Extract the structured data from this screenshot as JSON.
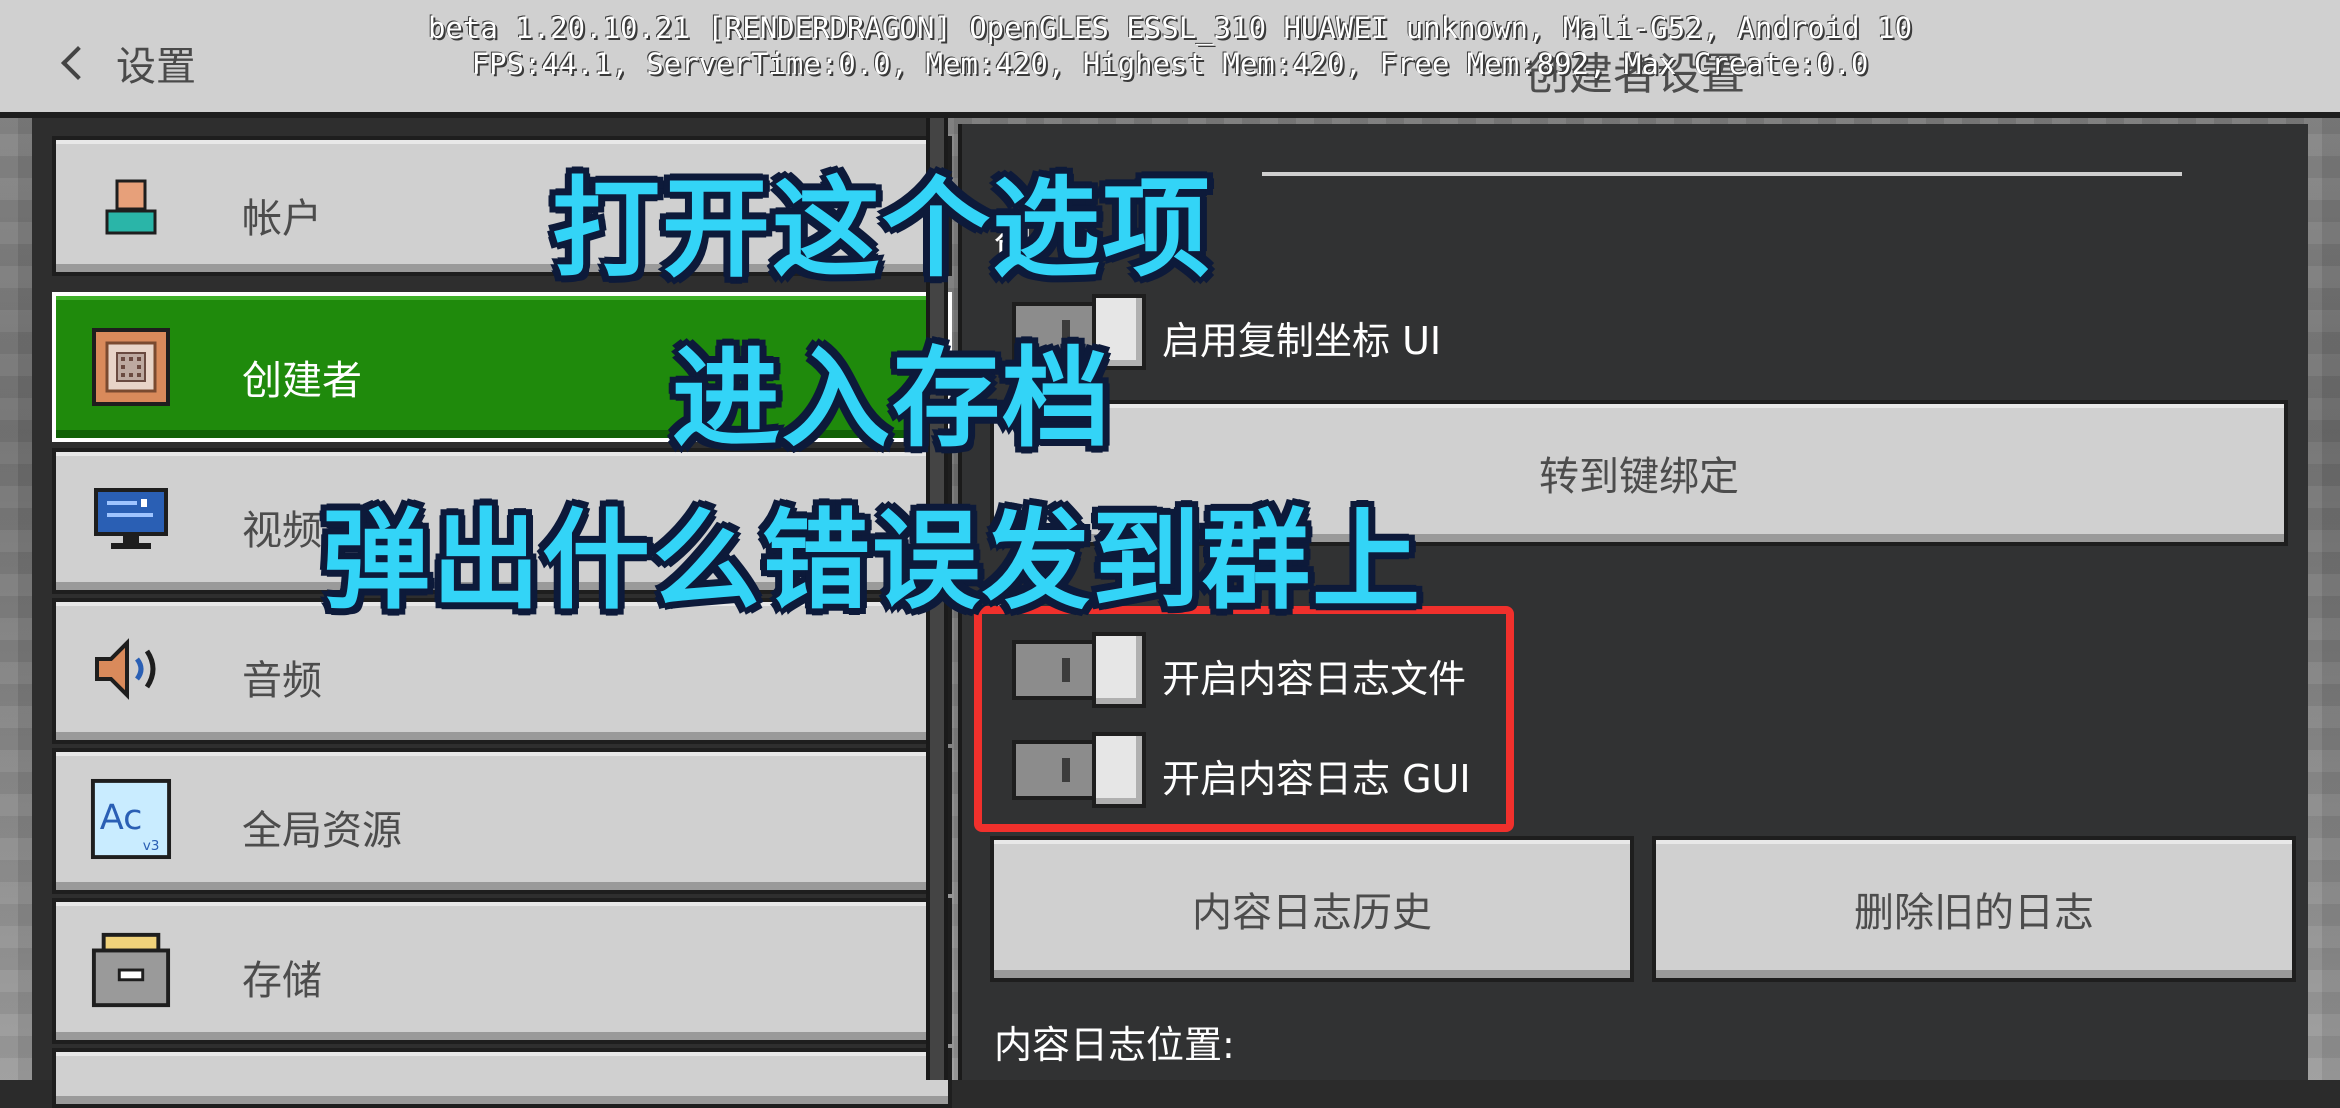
{
  "header": {
    "back_label": "设置",
    "debug_line1": "beta 1.20.10.21 [RENDERDRAGON] OpenGLES ESSL_310 HUAWEI unknown, Mali-G52, Android 10",
    "debug_line2": "FPS:44.1, ServerTime:0.0, Mem:420, Highest Mem:420, Free Mem:892, Max Create:0.0",
    "title": "创建者设置"
  },
  "sidebar": {
    "items": [
      {
        "label": "帐户",
        "icon": "account-icon"
      },
      {
        "label": "创建者",
        "icon": "command-block-icon",
        "selected": true
      },
      {
        "label": "视频",
        "icon": "monitor-icon"
      },
      {
        "label": "音频",
        "icon": "speaker-icon"
      },
      {
        "label": "全局资源",
        "icon": "global-resources-icon"
      },
      {
        "label": "存储",
        "icon": "storage-icon"
      }
    ]
  },
  "panel": {
    "section_creator": "创",
    "toggle_copy_coords": "启用复制坐标 UI",
    "button_keybind": "转到键绑定",
    "section_content_log": "内",
    "toggle_log_file": "开启内容日志文件",
    "toggle_log_gui": "开启内容日志 GUI",
    "button_log_history": "内容日志历史",
    "button_delete_logs": "删除旧的日志",
    "log_location_label": "内容日志位置:"
  },
  "overlay": {
    "line1": "打开这个选项",
    "line2": "进入存档",
    "line3": "弹出什么错误发到群上"
  },
  "colors": {
    "selected_green": "#1f8a0c",
    "highlight_red": "#f0302c",
    "overlay_cyan": "#33d4f7"
  }
}
